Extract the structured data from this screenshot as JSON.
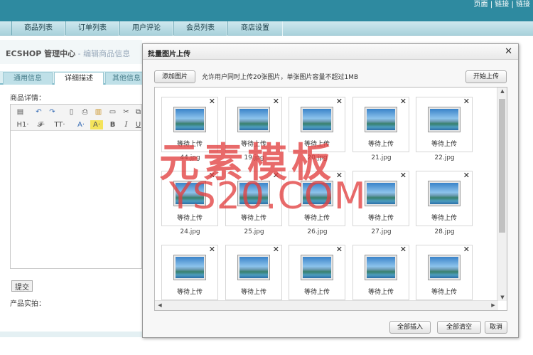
{
  "top_links": "页面 | 链接 | 链接",
  "nav": {
    "tabs": [
      "商品列表",
      "订单列表",
      "用户评论",
      "会员列表",
      "商店设置"
    ]
  },
  "breadcrumb": {
    "main": "ECSHOP 管理中心",
    "sub": " - 编辑商品信息"
  },
  "sub_tabs": [
    "通用信息",
    "详细描述",
    "其他信息"
  ],
  "editor": {
    "label": "商品详情：",
    "toolbar_row2": [
      "H1·",
      "𝓕·",
      "TT·",
      "A·",
      "A·",
      "B",
      "I",
      "U"
    ]
  },
  "submit_label": "提交",
  "actual_label": "产品实拍：",
  "dialog": {
    "title": "批量图片上传",
    "add_button": "添加图片",
    "tip": "允许用户同时上传20张图片，单张图片容量不超过1MB",
    "start_button": "开始上传",
    "status_text": "等待上传",
    "files": [
      {
        "name": "44.jpg"
      },
      {
        "name": "19.jpg"
      },
      {
        "name": "20.jpg"
      },
      {
        "name": "21.jpg"
      },
      {
        "name": "22.jpg"
      },
      {
        "name": "24.jpg"
      },
      {
        "name": "25.jpg"
      },
      {
        "name": "26.jpg"
      },
      {
        "name": "27.jpg"
      },
      {
        "name": "28.jpg"
      },
      {
        "name": ""
      },
      {
        "name": ""
      },
      {
        "name": ""
      },
      {
        "name": ""
      },
      {
        "name": ""
      }
    ],
    "insert_all_button": "全部插入",
    "clear_all_button": "全部清空",
    "cancel_button": "取消"
  },
  "watermark": {
    "cn": "元素模板",
    "en": "YS20.COM"
  }
}
